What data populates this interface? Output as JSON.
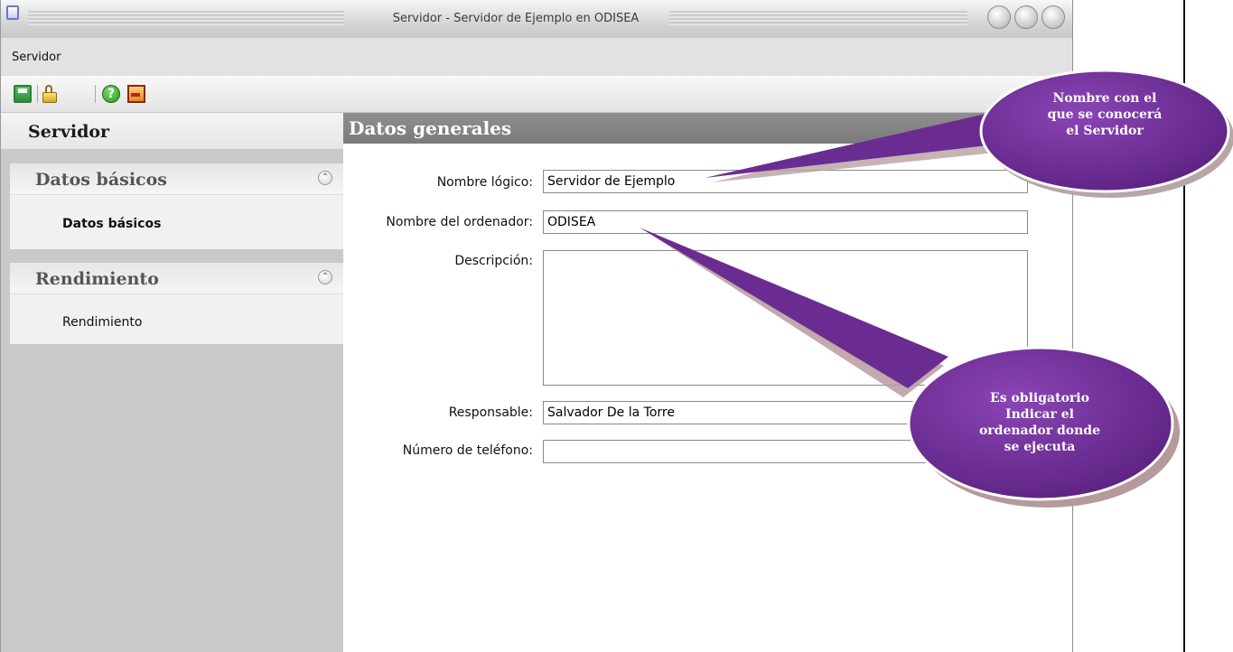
{
  "window": {
    "title": "Servidor - Servidor de Ejemplo en ODISEA"
  },
  "menu": {
    "items": [
      "Servidor"
    ]
  },
  "toolbar": {
    "icons": [
      "save-icon",
      "lock-icon",
      "help-icon",
      "exit-icon"
    ]
  },
  "sidebar": {
    "header": "Servidor",
    "groups": [
      {
        "title": "Datos básicos",
        "link": "Datos básicos"
      },
      {
        "title": "Rendimiento",
        "link": "Rendimiento"
      }
    ]
  },
  "main": {
    "section_title": "Datos generales",
    "fields": {
      "nombre_logico": {
        "label": "Nombre lógico:",
        "value": "Servidor de Ejemplo"
      },
      "nombre_ordenador": {
        "label": "Nombre del ordenador:",
        "value": "ODISEA"
      },
      "descripcion": {
        "label": "Descripción:",
        "value": ""
      },
      "responsable": {
        "label": "Responsable:",
        "value": "Salvador De la Torre"
      },
      "telefono": {
        "label": "Número de teléfono:",
        "value": ""
      }
    }
  },
  "callouts": {
    "top": {
      "lines": [
        "Nombre con el",
        "que se conocerá",
        "el Servidor"
      ]
    },
    "bottom": {
      "lines": [
        "Es obligatorio",
        "Indicar el",
        "ordenador donde",
        "se ejecuta"
      ]
    },
    "color": "#6b2c91"
  }
}
